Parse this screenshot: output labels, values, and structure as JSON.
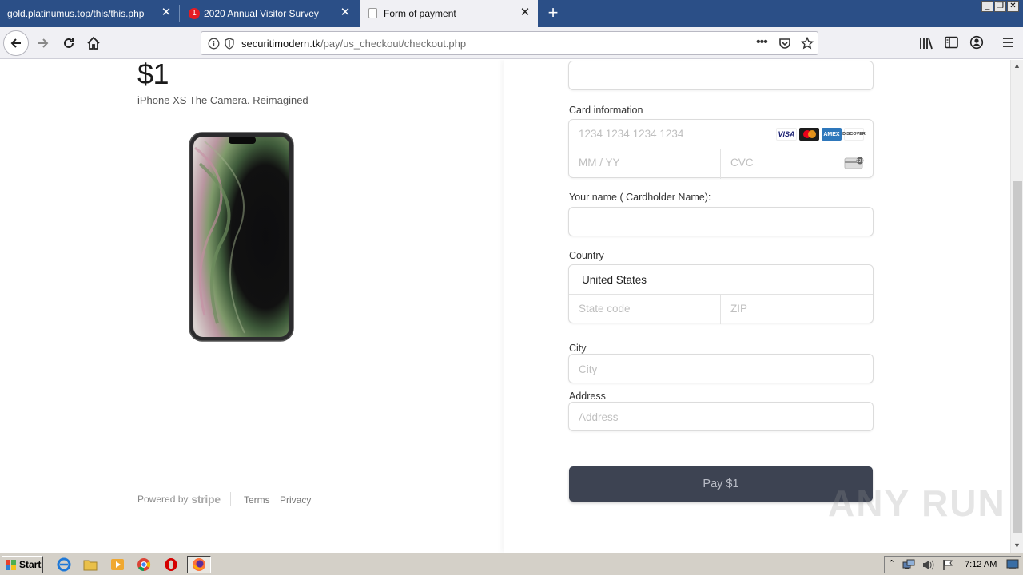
{
  "browser": {
    "tabs": [
      {
        "title": "gold.platinumus.top/this/this.php",
        "active": false
      },
      {
        "title": "2020 Annual Visitor Survey",
        "active": false,
        "badge": "1"
      },
      {
        "title": "Form of payment",
        "active": true
      }
    ],
    "address": {
      "domain": "securitimodern.tk",
      "path": "/pay/us_checkout/checkout.php"
    }
  },
  "product": {
    "price": "$1",
    "name": "iPhone XS The Camera. Reimagined"
  },
  "footer": {
    "powered_by": "Powered by",
    "stripe": "stripe",
    "terms": "Terms",
    "privacy": "Privacy"
  },
  "form": {
    "card_label": "Card information",
    "card_number_placeholder": "1234 1234 1234 1234",
    "expiry_placeholder": "MM / YY",
    "cvc_placeholder": "CVC",
    "card_brands": [
      "VISA",
      "Mastercard",
      "AMEX",
      "DISCOVER"
    ],
    "name_label": "Your name ( Cardholder Name):",
    "country_label": "Country",
    "country_value": "United States",
    "state_placeholder": "State code",
    "zip_placeholder": "ZIP",
    "city_label": "City",
    "city_placeholder": "City",
    "address_label": "Address",
    "address_placeholder": "Address",
    "pay_button": "Pay $1"
  },
  "watermark": "ANY RUN",
  "taskbar": {
    "start": "Start",
    "clock": "7:12 AM"
  }
}
